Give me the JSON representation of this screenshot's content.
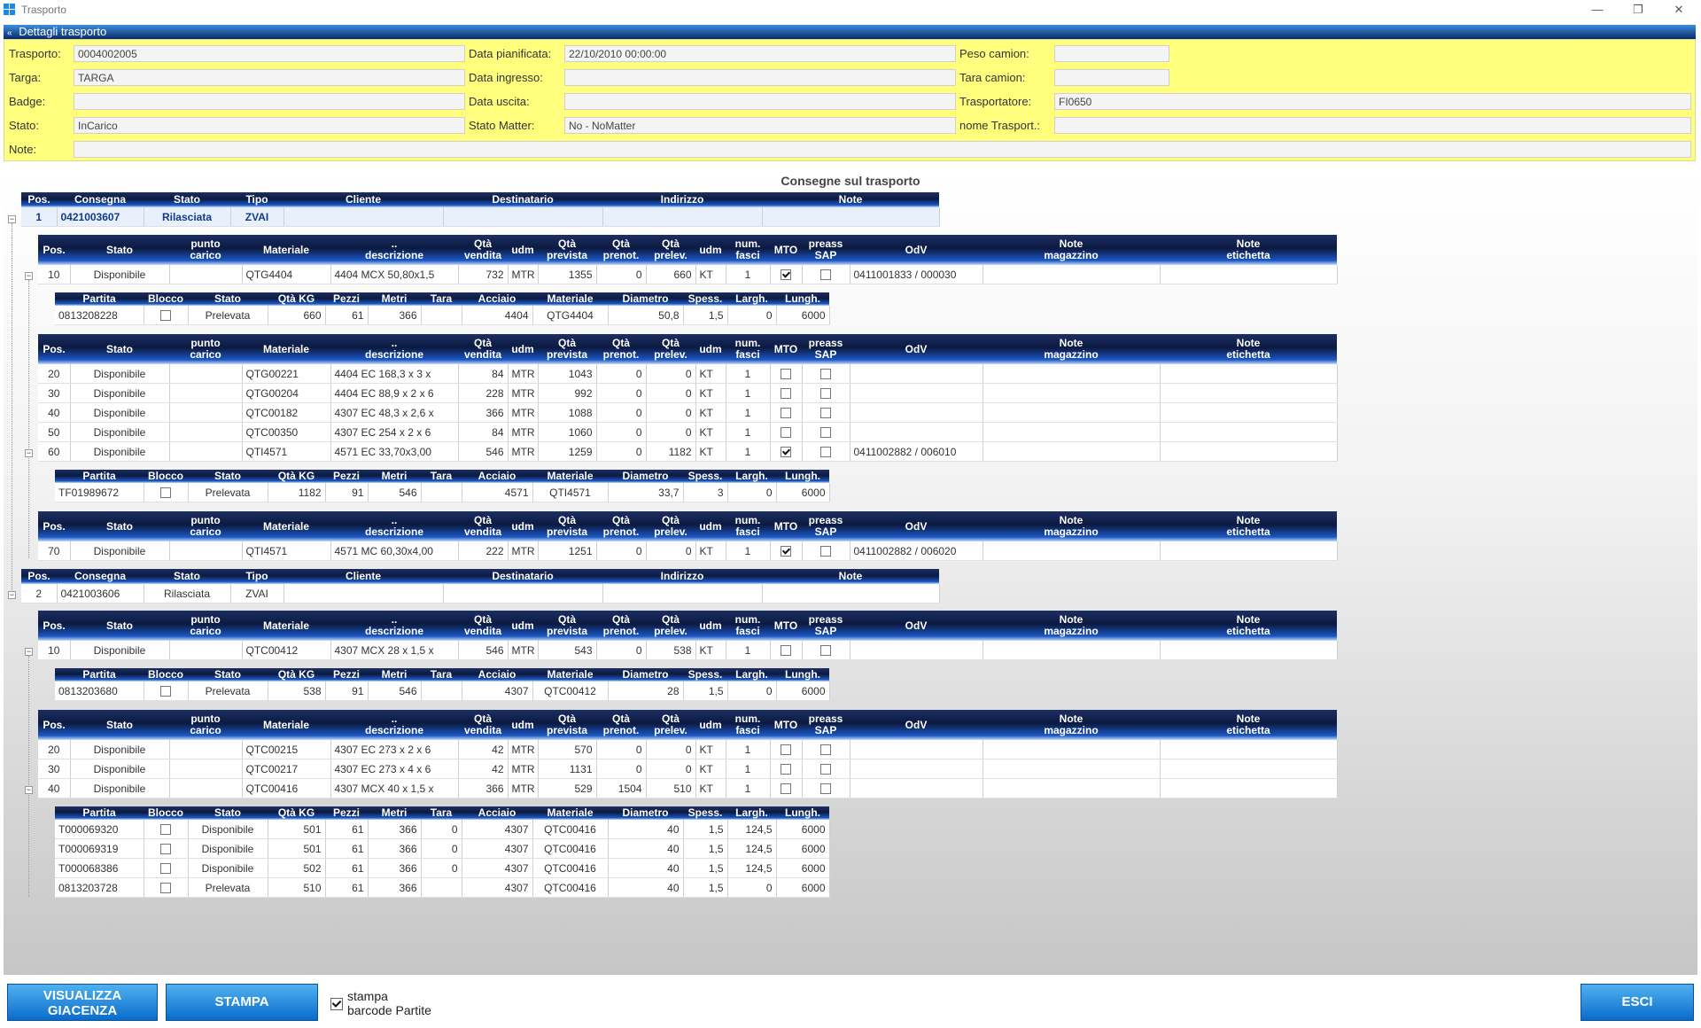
{
  "window": {
    "title": "Trasporto",
    "minimize": "—",
    "restore": "❐",
    "close": "✕"
  },
  "details": {
    "header": "Dettagli trasporto",
    "collapse_glyph": "«",
    "fields": [
      {
        "label": "Trasporto:",
        "value": "0004002005"
      },
      {
        "label": "Targa:",
        "value": "TARGA"
      },
      {
        "label": "Badge:",
        "value": ""
      },
      {
        "label": "Stato:",
        "value": "InCarico"
      },
      {
        "label": "Note:",
        "value": ""
      },
      {
        "label": "Data pianificata:",
        "value": "22/10/2010 00:00:00"
      },
      {
        "label": "Data ingresso:",
        "value": ""
      },
      {
        "label": "Data uscita:",
        "value": ""
      },
      {
        "label": "Stato Matter:",
        "value": "No - NoMatter"
      },
      {
        "label": "Peso camion:",
        "value": ""
      },
      {
        "label": "Tara camion:",
        "value": ""
      },
      {
        "label": "Trasportatore:",
        "value": "FI0650"
      },
      {
        "label": "nome Trasport.:",
        "value": ""
      }
    ]
  },
  "grid_title": "Consegne sul trasporto",
  "consegna_headers": [
    "Pos.",
    "Consegna",
    "Stato",
    "Tipo",
    "Cliente",
    "Destinatario",
    "Indirizzo",
    "Note"
  ],
  "riga_headers": [
    "Pos.",
    "Stato",
    "punto carico",
    "Materiale",
    ".. descrizione",
    "Qtà vendita",
    "udm",
    "Qtà prevista",
    "Qtà prenot.",
    "Qtà prelev.",
    "udm",
    "num. fasci",
    "MTO",
    "preass SAP",
    "OdV",
    "Note magazzino",
    "Note etichetta"
  ],
  "partita_headers": [
    "Partita",
    "Blocco",
    "Stato",
    "Qtà KG",
    "Pezzi",
    "Metri",
    "Tara",
    "Acciaio",
    "Materiale",
    "Diametro",
    "Spess.",
    "Largh.",
    "Lungh."
  ],
  "consegne": [
    {
      "pos": "1",
      "consegna": "0421003607",
      "stato": "Rilasciata",
      "tipo": "ZVAI",
      "cliente": "",
      "destinatario": "",
      "indirizzo": "",
      "note": ""
    },
    {
      "pos": "2",
      "consegna": "0421003606",
      "stato": "Rilasciata",
      "tipo": "ZVAI",
      "cliente": "",
      "destinatario": "",
      "indirizzo": "",
      "note": ""
    }
  ],
  "righe_groups": [
    {
      "rows": [
        {
          "pos": "10",
          "stato": "Disponibile",
          "punto": "",
          "mat": "QTG4404",
          "desc": "4404 MCX 50,80x1,5",
          "qven": "732",
          "udm1": "MTR",
          "qprev": "1355",
          "qpren": "0",
          "qprel": "660",
          "udm2": "KT",
          "fasci": "1",
          "mto": true,
          "sap": false,
          "odv": "0411001833 / 000030",
          "nmag": "",
          "neti": ""
        }
      ]
    },
    {
      "rows": [
        {
          "pos": "20",
          "stato": "Disponibile",
          "punto": "",
          "mat": "QTG00221",
          "desc": "4404 EC 168,3 x 3 x",
          "qven": "84",
          "udm1": "MTR",
          "qprev": "1043",
          "qpren": "0",
          "qprel": "0",
          "udm2": "KT",
          "fasci": "1",
          "mto": false,
          "sap": false,
          "odv": "",
          "nmag": "",
          "neti": ""
        },
        {
          "pos": "30",
          "stato": "Disponibile",
          "punto": "",
          "mat": "QTG00204",
          "desc": "4404 EC 88,9 x 2 x 6",
          "qven": "228",
          "udm1": "MTR",
          "qprev": "992",
          "qpren": "0",
          "qprel": "0",
          "udm2": "KT",
          "fasci": "1",
          "mto": false,
          "sap": false,
          "odv": "",
          "nmag": "",
          "neti": ""
        },
        {
          "pos": "40",
          "stato": "Disponibile",
          "punto": "",
          "mat": "QTC00182",
          "desc": "4307 EC 48,3 x 2,6 x",
          "qven": "366",
          "udm1": "MTR",
          "qprev": "1088",
          "qpren": "0",
          "qprel": "0",
          "udm2": "KT",
          "fasci": "1",
          "mto": false,
          "sap": false,
          "odv": "",
          "nmag": "",
          "neti": ""
        },
        {
          "pos": "50",
          "stato": "Disponibile",
          "punto": "",
          "mat": "QTC00350",
          "desc": "4307 EC 254 x 2 x 6",
          "qven": "84",
          "udm1": "MTR",
          "qprev": "1060",
          "qpren": "0",
          "qprel": "0",
          "udm2": "KT",
          "fasci": "1",
          "mto": false,
          "sap": false,
          "odv": "",
          "nmag": "",
          "neti": ""
        },
        {
          "pos": "60",
          "stato": "Disponibile",
          "punto": "",
          "mat": "QTI4571",
          "desc": "4571 EC 33,70x3,00",
          "qven": "546",
          "udm1": "MTR",
          "qprev": "1259",
          "qpren": "0",
          "qprel": "1182",
          "udm2": "KT",
          "fasci": "1",
          "mto": true,
          "sap": false,
          "odv": "0411002882 / 006010",
          "nmag": "",
          "neti": ""
        }
      ]
    },
    {
      "rows": [
        {
          "pos": "70",
          "stato": "Disponibile",
          "punto": "",
          "mat": "QTI4571",
          "desc": "4571 MC 60,30x4,00",
          "qven": "222",
          "udm1": "MTR",
          "qprev": "1251",
          "qpren": "0",
          "qprel": "0",
          "udm2": "KT",
          "fasci": "1",
          "mto": true,
          "sap": false,
          "odv": "0411002882 / 006020",
          "nmag": "",
          "neti": ""
        }
      ]
    },
    {
      "rows": [
        {
          "pos": "10",
          "stato": "Disponibile",
          "punto": "",
          "mat": "QTC00412",
          "desc": "4307 MCX 28 x 1,5 x",
          "qven": "546",
          "udm1": "MTR",
          "qprev": "543",
          "qpren": "0",
          "qprel": "538",
          "udm2": "KT",
          "fasci": "1",
          "mto": false,
          "sap": false,
          "odv": "",
          "nmag": "",
          "neti": ""
        }
      ]
    },
    {
      "rows": [
        {
          "pos": "20",
          "stato": "Disponibile",
          "punto": "",
          "mat": "QTC00215",
          "desc": "4307 EC 273 x 2 x 6",
          "qven": "42",
          "udm1": "MTR",
          "qprev": "570",
          "qpren": "0",
          "qprel": "0",
          "udm2": "KT",
          "fasci": "1",
          "mto": false,
          "sap": false,
          "odv": "",
          "nmag": "",
          "neti": ""
        },
        {
          "pos": "30",
          "stato": "Disponibile",
          "punto": "",
          "mat": "QTC00217",
          "desc": "4307 EC 273 x 4 x 6",
          "qven": "42",
          "udm1": "MTR",
          "qprev": "1131",
          "qpren": "0",
          "qprel": "0",
          "udm2": "KT",
          "fasci": "1",
          "mto": false,
          "sap": false,
          "odv": "",
          "nmag": "",
          "neti": ""
        },
        {
          "pos": "40",
          "stato": "Disponibile",
          "punto": "",
          "mat": "QTC00416",
          "desc": "4307 MCX 40 x 1,5 x",
          "qven": "366",
          "udm1": "MTR",
          "qprev": "529",
          "qpren": "1504",
          "qprel": "510",
          "udm2": "KT",
          "fasci": "1",
          "mto": false,
          "sap": false,
          "odv": "",
          "nmag": "",
          "neti": ""
        }
      ]
    }
  ],
  "partite_groups": [
    {
      "rows": [
        {
          "partita": "0813208228",
          "blocco": false,
          "stato": "Prelevata",
          "kg": "660",
          "pezzi": "61",
          "metri": "366",
          "tara": "",
          "acciaio": "4404",
          "mat": "QTG4404",
          "diam": "50,8",
          "spess": "1,5",
          "largh": "0",
          "lungh": "6000"
        }
      ]
    },
    {
      "rows": [
        {
          "partita": "TF01989672",
          "blocco": false,
          "stato": "Prelevata",
          "kg": "1182",
          "pezzi": "91",
          "metri": "546",
          "tara": "",
          "acciaio": "4571",
          "mat": "QTI4571",
          "diam": "33,7",
          "spess": "3",
          "largh": "0",
          "lungh": "6000"
        }
      ]
    },
    {
      "rows": [
        {
          "partita": "0813203680",
          "blocco": false,
          "stato": "Prelevata",
          "kg": "538",
          "pezzi": "91",
          "metri": "546",
          "tara": "",
          "acciaio": "4307",
          "mat": "QTC00412",
          "diam": "28",
          "spess": "1,5",
          "largh": "0",
          "lungh": "6000"
        }
      ]
    },
    {
      "rows": [
        {
          "partita": "T000069320",
          "blocco": false,
          "stato": "Disponibile",
          "kg": "501",
          "pezzi": "61",
          "metri": "366",
          "tara": "0",
          "acciaio": "4307",
          "mat": "QTC00416",
          "diam": "40",
          "spess": "1,5",
          "largh": "124,5",
          "lungh": "6000"
        },
        {
          "partita": "T000069319",
          "blocco": false,
          "stato": "Disponibile",
          "kg": "501",
          "pezzi": "61",
          "metri": "366",
          "tara": "0",
          "acciaio": "4307",
          "mat": "QTC00416",
          "diam": "40",
          "spess": "1,5",
          "largh": "124,5",
          "lungh": "6000"
        },
        {
          "partita": "T000068386",
          "blocco": false,
          "stato": "Disponibile",
          "kg": "502",
          "pezzi": "61",
          "metri": "366",
          "tara": "0",
          "acciaio": "4307",
          "mat": "QTC00416",
          "diam": "40",
          "spess": "1,5",
          "largh": "124,5",
          "lungh": "6000"
        },
        {
          "partita": "0813203728",
          "blocco": false,
          "stato": "Prelevata",
          "kg": "510",
          "pezzi": "61",
          "metri": "366",
          "tara": "",
          "acciaio": "4307",
          "mat": "QTC00416",
          "diam": "40",
          "spess": "1,5",
          "largh": "0",
          "lungh": "6000"
        }
      ]
    }
  ],
  "footer": {
    "visualizza_line1": "VISUALIZZA",
    "visualizza_line2": "GIACENZA",
    "stampa": "STAMPA",
    "stampa_barcode_line1": "stampa",
    "stampa_barcode_line2": "barcode Partite",
    "stampa_barcode_checked": true,
    "esci": "ESCI"
  },
  "tree_glyph": "−"
}
